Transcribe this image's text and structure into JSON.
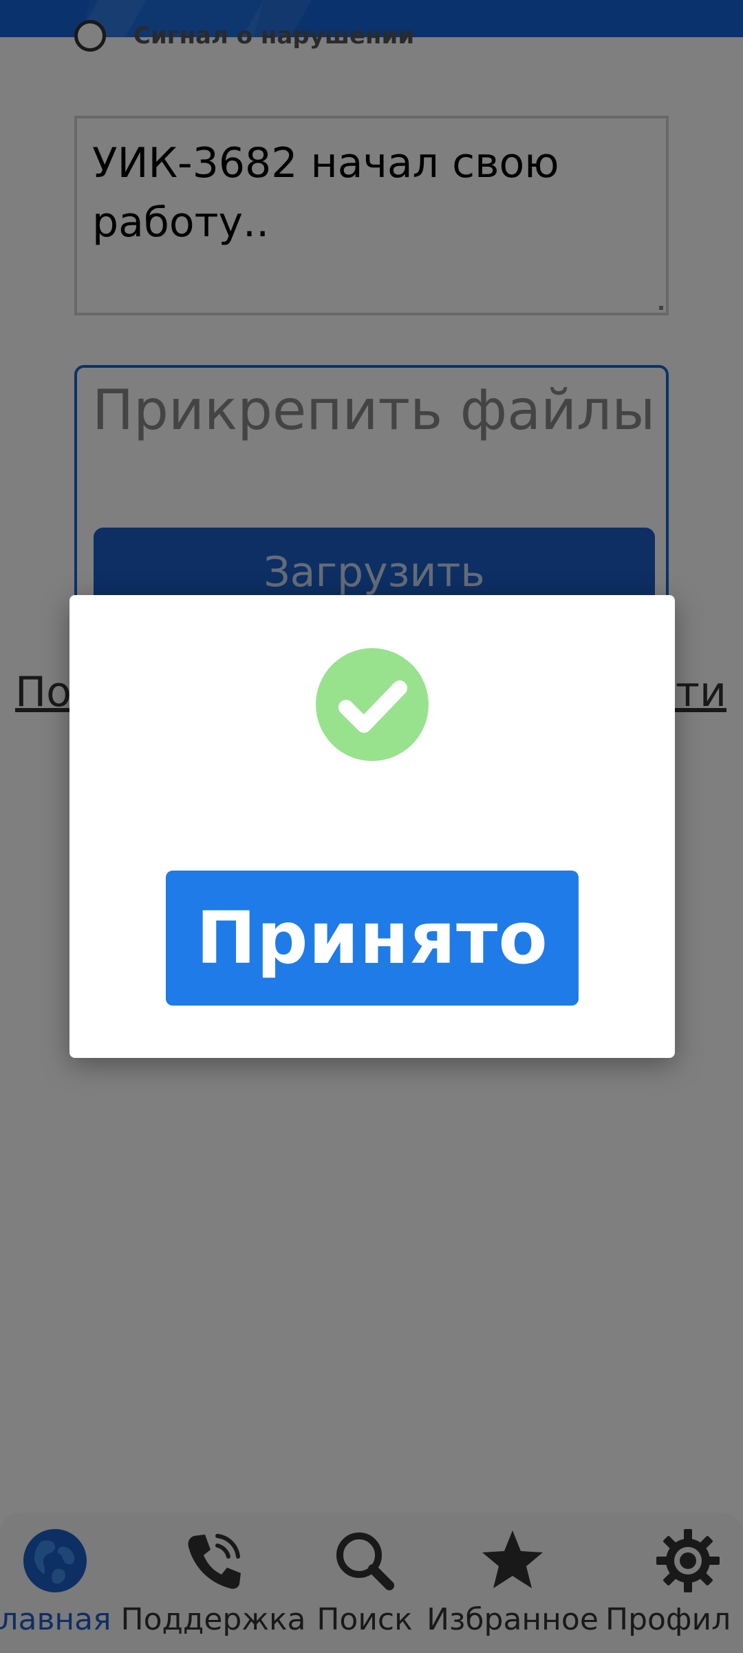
{
  "form": {
    "radio_label": "Сигнал о нарушении",
    "message_text": "УИК-3682 начал свою работу..",
    "attach_title": "Прикрепить файлы",
    "upload_label": "Загрузить",
    "link_left": "По",
    "link_right": "сти"
  },
  "modal": {
    "icon": "check-circle-icon",
    "accept_label": "Принято"
  },
  "bottom_nav": {
    "items": [
      {
        "label": "лавная",
        "icon": "globe-icon",
        "active": true
      },
      {
        "label": "Поддержка",
        "icon": "phone-icon",
        "active": false
      },
      {
        "label": "Поиск",
        "icon": "search-icon",
        "active": false
      },
      {
        "label": "Избранное",
        "icon": "star-icon",
        "active": false
      },
      {
        "label": "Профил",
        "icon": "gear-icon",
        "active": false
      }
    ]
  },
  "colors": {
    "accent": "#1e7be8",
    "brand": "#1565d8",
    "success": "#98e28e",
    "overlay": "#000000"
  }
}
